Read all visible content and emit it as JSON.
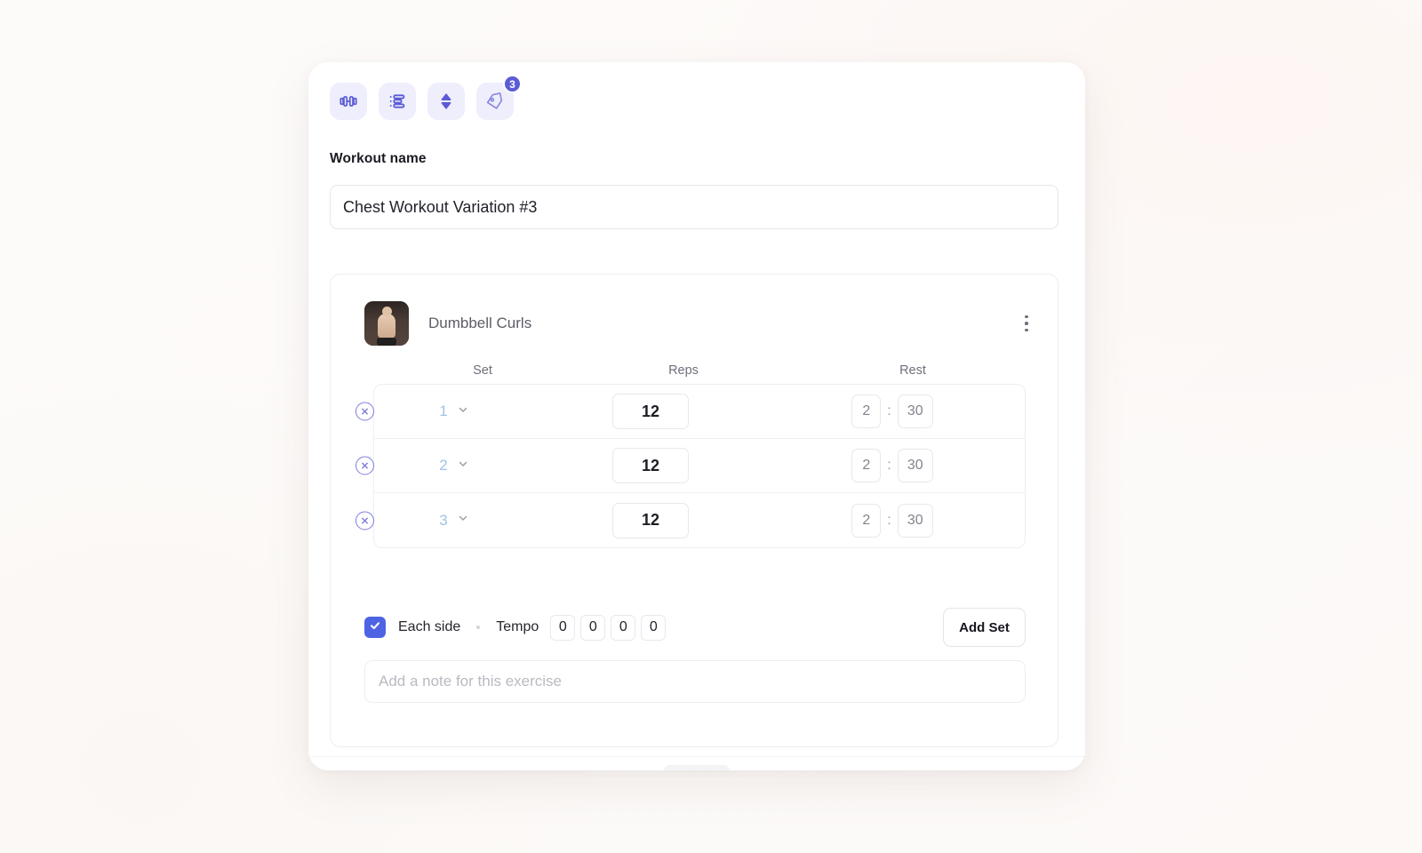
{
  "toolbar": {
    "buttons": [
      {
        "name": "dumbbell-icon",
        "label": "Exercises"
      },
      {
        "name": "list-icon",
        "label": "Sets list"
      },
      {
        "name": "sort-icon",
        "label": "Reorder"
      },
      {
        "name": "tag-icon",
        "label": "Tags",
        "badge": "3"
      }
    ]
  },
  "workout": {
    "name_label": "Workout name",
    "name_value": "Chest Workout Variation #3",
    "name_placeholder": "Workout name"
  },
  "exercise": {
    "title": "Dumbbell Curls",
    "menu_label": "More options",
    "columns": {
      "set": "Set",
      "reps": "Reps",
      "rest": "Rest"
    },
    "sets": [
      {
        "index": "1",
        "reps": "12",
        "rest_min": "2",
        "rest_sec": "30",
        "sep": ":"
      },
      {
        "index": "2",
        "reps": "12",
        "rest_min": "2",
        "rest_sec": "30",
        "sep": ":"
      },
      {
        "index": "3",
        "reps": "12",
        "rest_min": "2",
        "rest_sec": "30",
        "sep": ":"
      }
    ],
    "each_side_label": "Each side",
    "each_side_checked": true,
    "tempo_label": "Tempo",
    "tempo_values": [
      "0",
      "0",
      "0",
      "0"
    ],
    "add_set_label": "Add Set",
    "note_placeholder": "Add a note for this exercise",
    "note_value": ""
  },
  "colors": {
    "accent": "#5b5bd6",
    "toolbar_icon_bg": "#eeeefc",
    "checkbox": "#4e63e4",
    "set_number": "#9fc2e4",
    "page_bg": "#fdfbf9",
    "card_bg": "#ffffff"
  }
}
